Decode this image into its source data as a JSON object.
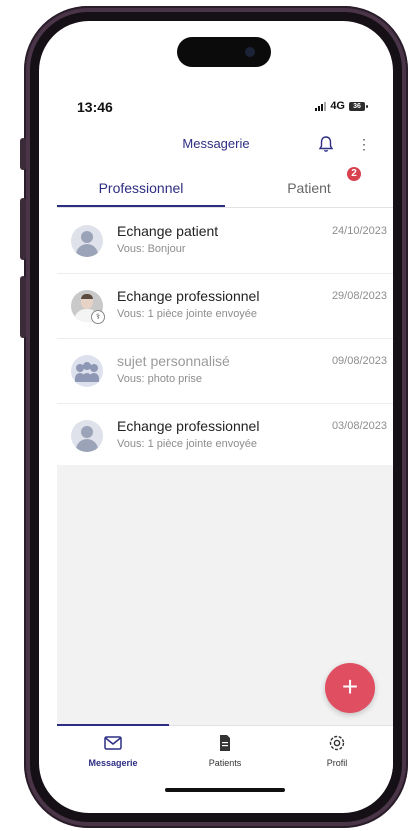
{
  "status_bar": {
    "time": "13:46",
    "network": "4G",
    "battery": "36"
  },
  "app_bar": {
    "title": "Messagerie",
    "bell_icon": "bell-icon",
    "menu_icon": "more-vertical-icon"
  },
  "tabs": [
    {
      "label": "Professionnel",
      "active": true
    },
    {
      "label": "Patient",
      "badge": "2",
      "active": false
    }
  ],
  "conversations": [
    {
      "title": "Echange patient",
      "subtitle": "Vous: Bonjour",
      "date": "24/10/2023",
      "avatar": "person-placeholder",
      "muted": false
    },
    {
      "title": "Echange professionnel",
      "subtitle": "Vous: 1 pièce jointe envoyée",
      "date": "29/08/2023",
      "avatar": "doctor-photo",
      "muted": false
    },
    {
      "title": "sujet personnalisé",
      "subtitle": "Vous: photo prise",
      "date": "09/08/2023",
      "avatar": "group-placeholder",
      "muted": true
    },
    {
      "title": "Echange professionnel",
      "subtitle": "Vous: 1 pièce jointe envoyée",
      "date": "03/08/2023",
      "avatar": "person-placeholder",
      "muted": false
    }
  ],
  "fab": {
    "label": "+"
  },
  "bottom_nav": [
    {
      "label": "Messagerie",
      "icon": "mail-icon",
      "active": true
    },
    {
      "label": "Patients",
      "icon": "document-icon",
      "active": false
    },
    {
      "label": "Profil",
      "icon": "gear-icon",
      "active": false
    }
  ],
  "colors": {
    "primary": "#2d2e83",
    "accent": "#e04e62",
    "badge": "#d9414f"
  }
}
